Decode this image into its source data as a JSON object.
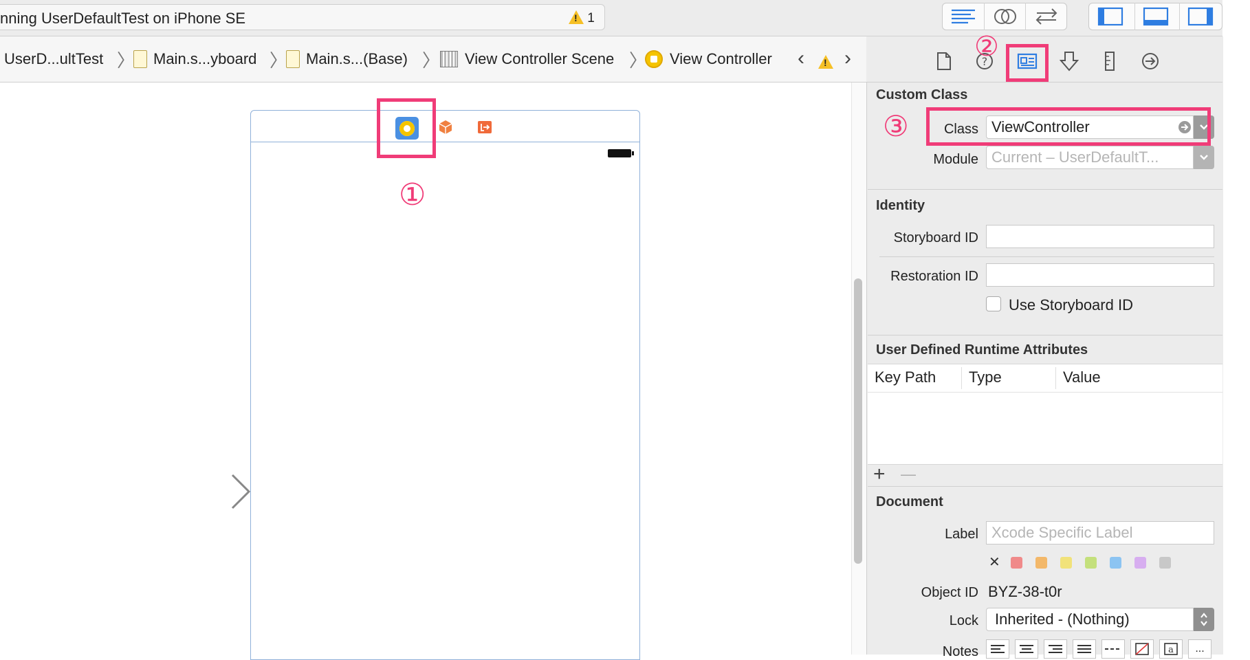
{
  "toolbar": {
    "activity_text": "nning UserDefaultTest on iPhone SE",
    "warning_count": "1",
    "editor_buttons": [
      "standard-editor-icon",
      "assistant-editor-icon",
      "version-editor-icon"
    ],
    "panel_buttons": [
      "navigator-panel-icon",
      "debug-area-icon",
      "utilities-panel-icon"
    ]
  },
  "jumpbar": {
    "crumbs": [
      "UserD...ultTest",
      "Main.s...yboard",
      "Main.s...(Base)",
      "View Controller Scene",
      "View Controller"
    ]
  },
  "annotations": {
    "one": "①",
    "two": "②",
    "three": "③"
  },
  "inspector": {
    "tabs": [
      "file-inspector-icon",
      "quick-help-icon",
      "identity-inspector-icon",
      "attributes-inspector-icon",
      "size-inspector-icon",
      "connections-inspector-icon"
    ],
    "custom_class": {
      "title": "Custom Class",
      "class_label": "Class",
      "class_value": "ViewController",
      "module_label": "Module",
      "module_placeholder": "Current – UserDefaultT..."
    },
    "identity": {
      "title": "Identity",
      "storyboard_id_label": "Storyboard ID",
      "storyboard_id_value": "",
      "restoration_id_label": "Restoration ID",
      "restoration_id_value": "",
      "use_storyboard_id_label": "Use Storyboard ID",
      "use_storyboard_id_checked": false
    },
    "runtime_attributes": {
      "title": "User Defined Runtime Attributes",
      "columns": [
        "Key Path",
        "Type",
        "Value"
      ],
      "add": "+",
      "remove": "—"
    },
    "document": {
      "title": "Document",
      "label_label": "Label",
      "label_placeholder": "Xcode Specific Label",
      "clear_glyph": "✕",
      "label_colors": [
        "#f08a8a",
        "#f3b86a",
        "#f1e27a",
        "#c4e07c",
        "#8cc4f2",
        "#d7aef0",
        "#c8c8c8"
      ],
      "object_id_label": "Object ID",
      "object_id_value": "BYZ-38-t0r",
      "lock_label": "Lock",
      "lock_value": "Inherited - (Nothing)",
      "notes_label": "Notes",
      "notes_more": "..."
    }
  }
}
